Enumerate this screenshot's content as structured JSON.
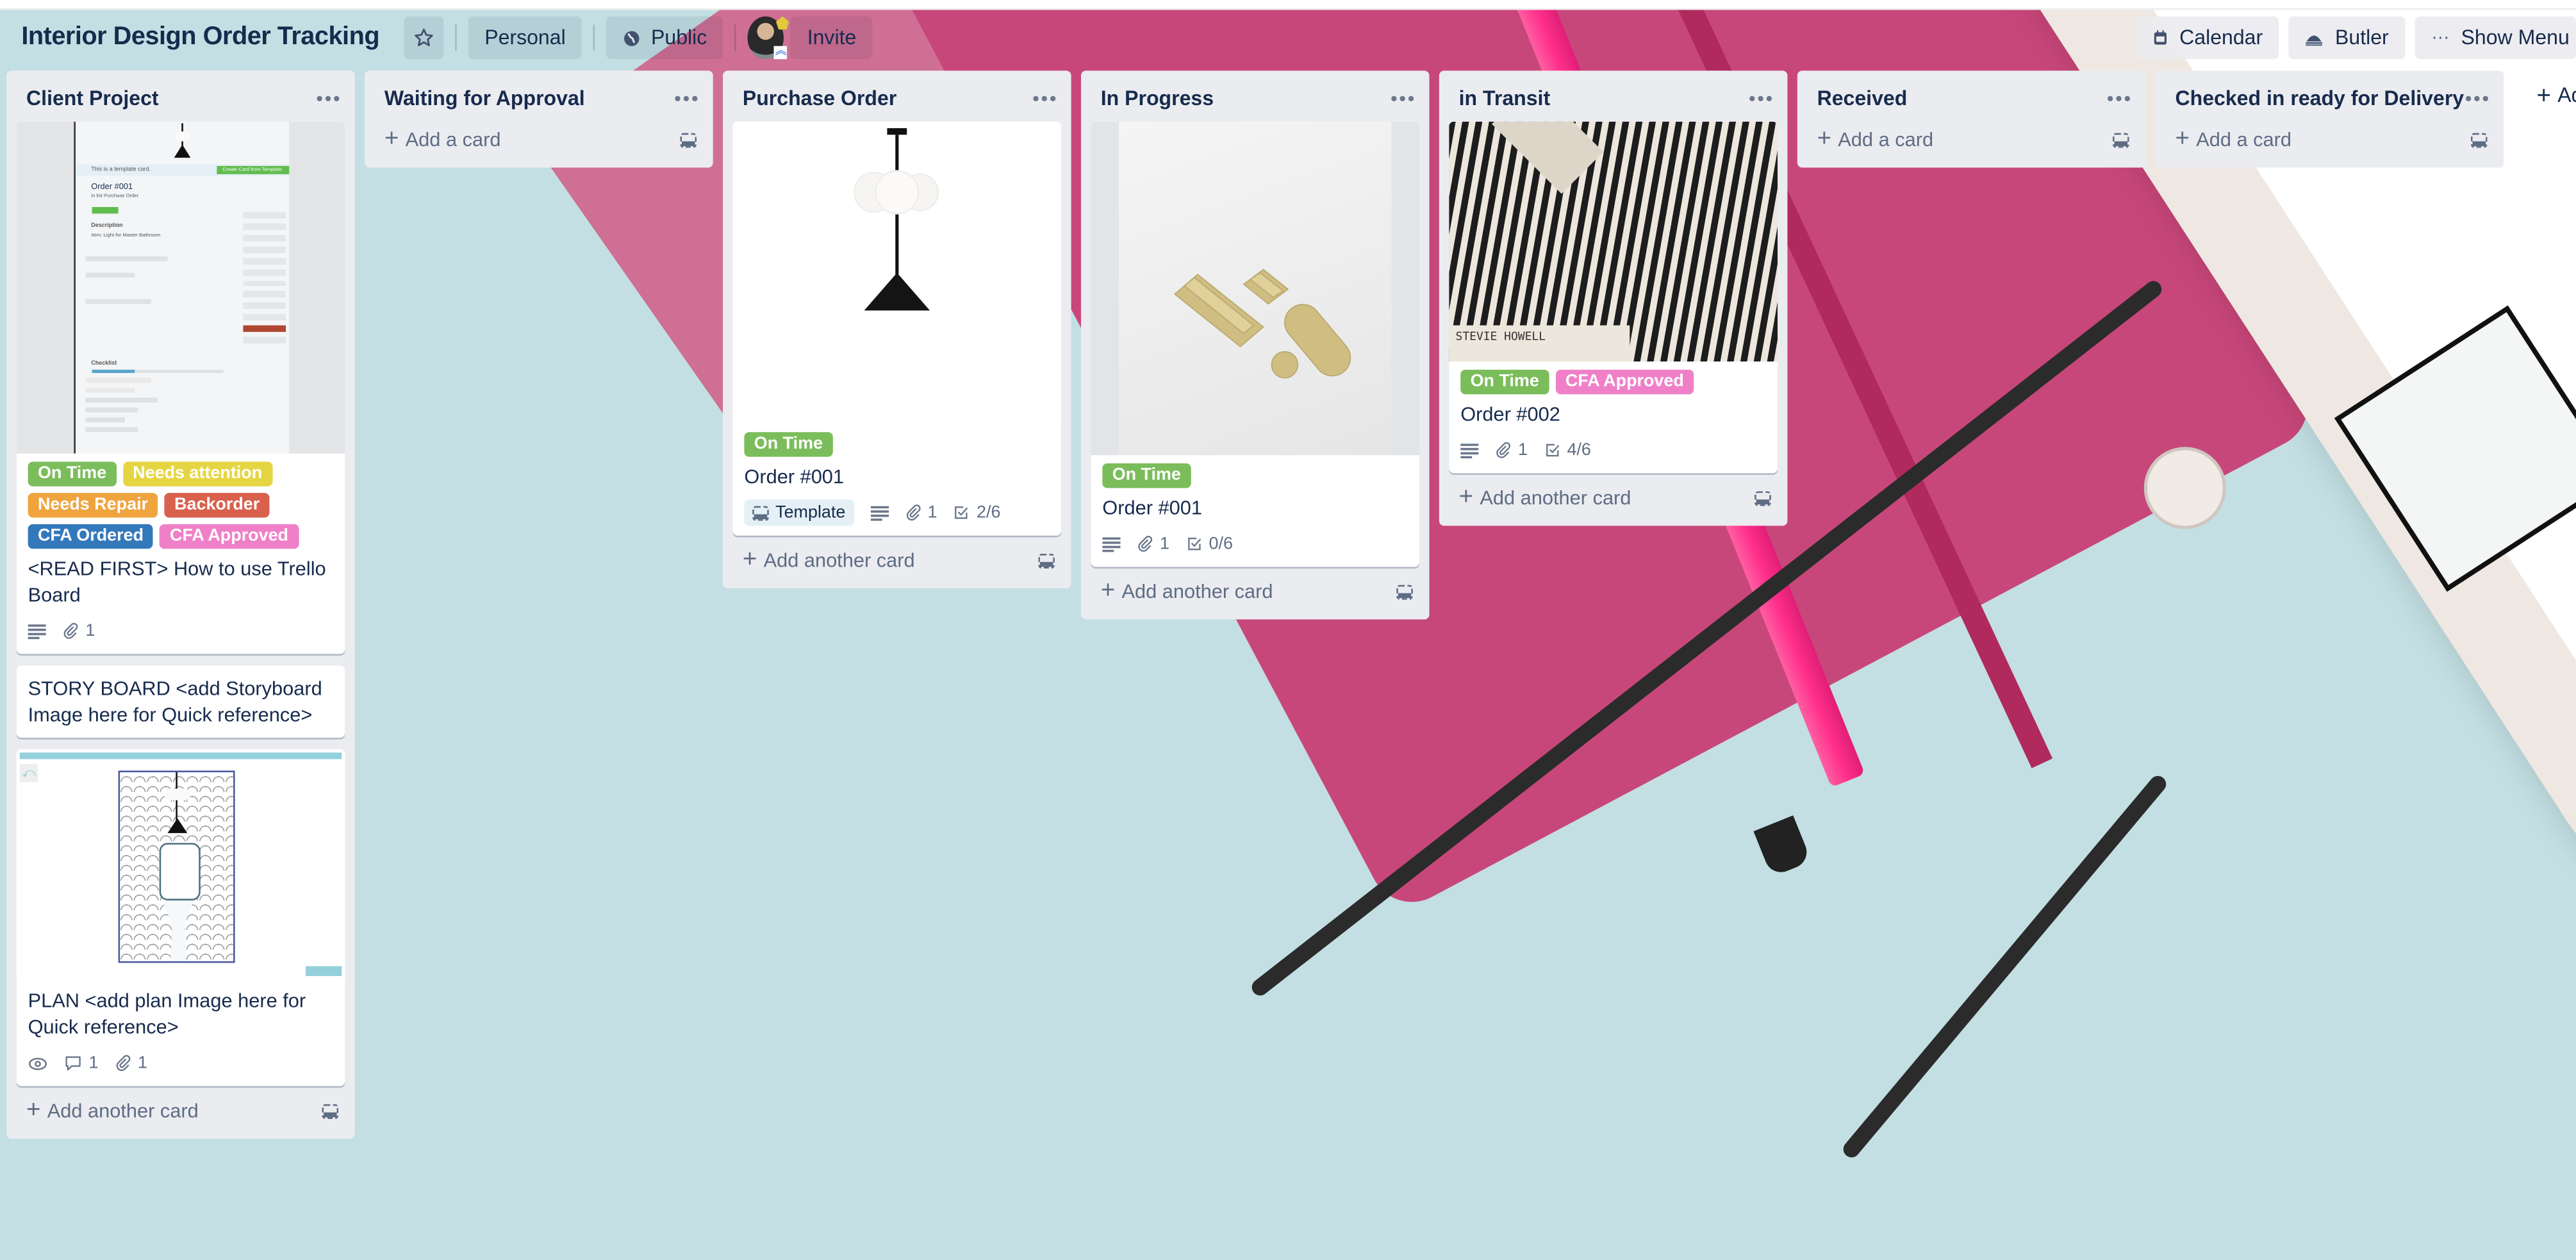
{
  "header": {
    "board_title": "Interior Design Order Tracking",
    "star_icon": "star-icon",
    "team_label": "Personal",
    "visibility_label": "Public",
    "invite_label": "Invite",
    "calendar_label": "Calendar",
    "butler_label": "Butler",
    "show_menu_label": "Show Menu"
  },
  "lists": [
    {
      "title": "Client Project",
      "menu": "•••",
      "cards": [
        {
          "cover": "card-screenshot",
          "labels": [
            {
              "text": "On Time",
              "color": "#61bd4f"
            },
            {
              "text": "Needs attention",
              "color": "#f2d600"
            },
            {
              "text": "Needs Repair",
              "color": "#ff9f1a"
            },
            {
              "text": "Backorder",
              "color": "#eb5a46"
            },
            {
              "text": "CFA Ordered",
              "color": "#0079bf"
            },
            {
              "text": "CFA Approved",
              "color": "#ff78cb"
            }
          ],
          "title": "<READ FIRST> How to use Trello Board",
          "badges": {
            "description": true,
            "attachments": "1"
          }
        },
        {
          "title": "STORY BOARD <add Storyboard Image here for Quick reference>"
        },
        {
          "cover": "plan-drawing",
          "title": "PLAN <add plan Image here for Quick reference>",
          "badges": {
            "watching": true,
            "comments": "1",
            "attachments": "1"
          }
        }
      ],
      "add_label": "Add another card"
    },
    {
      "title": "Waiting for Approval",
      "menu": "•••",
      "cards": [],
      "add_label": "Add a card"
    },
    {
      "title": "Purchase Order",
      "menu": "•••",
      "cards": [
        {
          "cover": "pendant-lamp",
          "labels": [
            {
              "text": "On Time",
              "color": "#61bd4f"
            }
          ],
          "title": "Order #001",
          "badges": {
            "template": "Template",
            "description": true,
            "attachments": "1",
            "checklist": "2/6"
          }
        }
      ],
      "add_label": "Add another card"
    },
    {
      "title": "In Progress",
      "menu": "•••",
      "cards": [
        {
          "cover": "brass-hardware",
          "labels": [
            {
              "text": "On Time",
              "color": "#61bd4f"
            }
          ],
          "title": "Order #001",
          "badges": {
            "description": true,
            "attachments": "1",
            "checklist": "0/6"
          }
        }
      ],
      "add_label": "Add another card"
    },
    {
      "title": "in Transit",
      "menu": "•••",
      "cards": [
        {
          "cover": "fabric-sample",
          "cover_caption": "STEVIE HOWELL",
          "labels": [
            {
              "text": "On Time",
              "color": "#61bd4f"
            },
            {
              "text": "CFA Approved",
              "color": "#ff78cb"
            }
          ],
          "title": "Order #002",
          "badges": {
            "description": true,
            "attachments": "1",
            "checklist": "4/6"
          }
        }
      ],
      "add_label": "Add another card"
    },
    {
      "title": "Received",
      "menu": "•••",
      "cards": [],
      "add_label": "Add a card"
    },
    {
      "title": "Checked in ready for Delivery",
      "menu": "•••",
      "cards": [],
      "add_label": "Add a card"
    }
  ],
  "add_list_label": "Ad",
  "cover_screenshot": {
    "banner": "This is a template card.",
    "create_button": "Create Card from Template",
    "title": "Order #001",
    "in_list": "in list Purchase Order",
    "description_label": "Description",
    "description": "Item: Light for Master Bathroom",
    "checklist_label": "Checklist"
  }
}
